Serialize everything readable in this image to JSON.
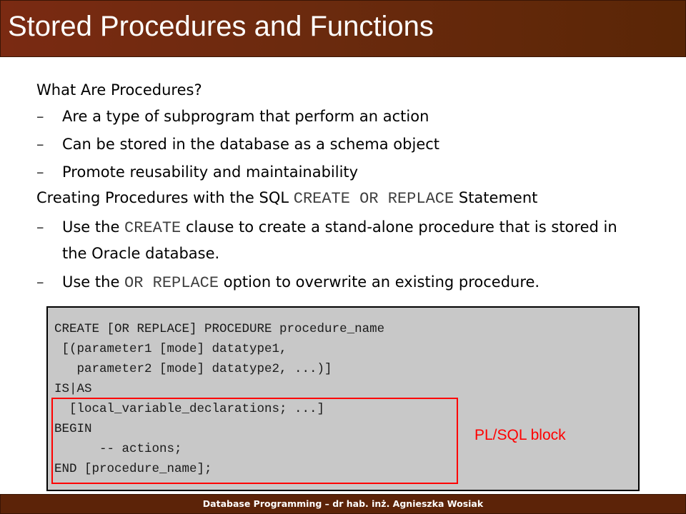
{
  "slide": {
    "title": "Stored Procedures and Functions",
    "footer": "Database Programming – dr hab. inż. Agnieszka Wosiak"
  },
  "content": {
    "heading1": "What Are Procedures?",
    "bullets1": [
      "Are a type of subprogram that perform an action",
      "Can be stored in the database as a schema object",
      "Promote reusability and maintainability"
    ],
    "heading2": {
      "before": "Creating Procedures with the SQL ",
      "code": "CREATE OR REPLACE",
      "after": " Statement"
    },
    "bullets2": [
      {
        "before": "Use the ",
        "code": "CREATE",
        "after": " clause to create a stand-alone procedure that is stored in",
        "continuation": "the Oracle database."
      },
      {
        "before": "Use the ",
        "code": "OR REPLACE",
        "after": " option to overwrite an existing procedure."
      }
    ],
    "dash_symbol": "–"
  },
  "code_block": {
    "lines": [
      "CREATE [OR REPLACE] PROCEDURE procedure_name",
      " [(parameter1 [mode] datatype1,",
      "   parameter2 [mode] datatype2, ...)]",
      "IS|AS",
      "  [local_variable_declarations; ...]",
      "BEGIN",
      "      -- actions;",
      "END [procedure_name];"
    ],
    "annotation": "PL/SQL block"
  },
  "colors": {
    "title_bar": "#6b2a0e",
    "code_background": "#c8c8c8",
    "highlight": "#ff0000"
  }
}
